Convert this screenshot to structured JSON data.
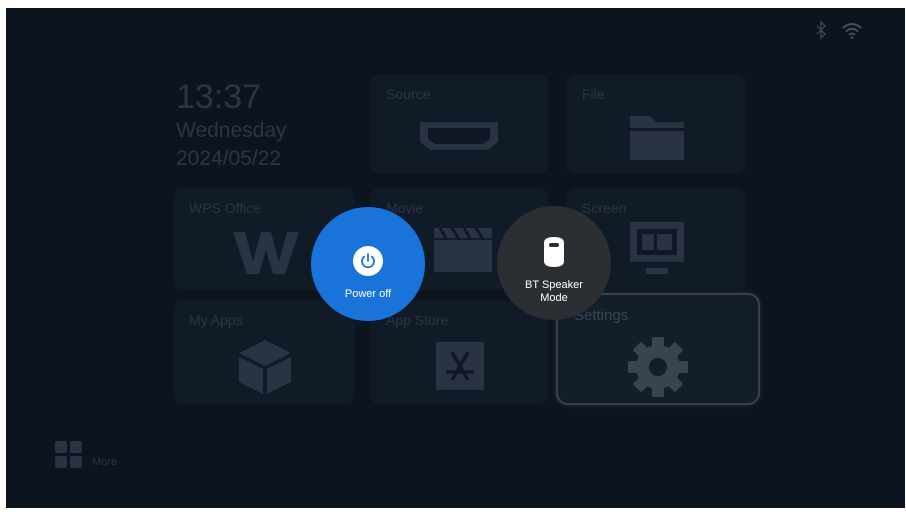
{
  "clock": {
    "time": "13:37",
    "weekday": "Wednesday",
    "date": "2024/05/22"
  },
  "status_icons": [
    "bluetooth-icon",
    "wifi-icon"
  ],
  "tiles": {
    "source": {
      "label": "Source",
      "icon": "hdmi-icon"
    },
    "file": {
      "label": "File",
      "icon": "folder-icon"
    },
    "wps": {
      "label": "WPS Office",
      "icon": "wps-logo-icon"
    },
    "movie": {
      "label": "Movie",
      "icon": "clapperboard-icon"
    },
    "screen": {
      "label": "Screen",
      "icon": "monitor-icon"
    },
    "myapps": {
      "label": "My Apps",
      "icon": "cube-icon"
    },
    "appstore": {
      "label": "App Store",
      "icon": "app-store-icon"
    },
    "settings": {
      "label": "Settings",
      "icon": "gear-icon"
    }
  },
  "more": {
    "label": "More",
    "icon": "grid-icon"
  },
  "overlay": {
    "power_off": {
      "label": "Power off",
      "icon": "power-icon",
      "color": "#1a73d9"
    },
    "bt_speaker": {
      "label": "BT Speaker Mode",
      "icon": "speaker-icon",
      "color": "#2b2f34"
    }
  },
  "colors": {
    "background": "#0c1420",
    "tile": "#111b28",
    "accent": "#1a73d9"
  }
}
